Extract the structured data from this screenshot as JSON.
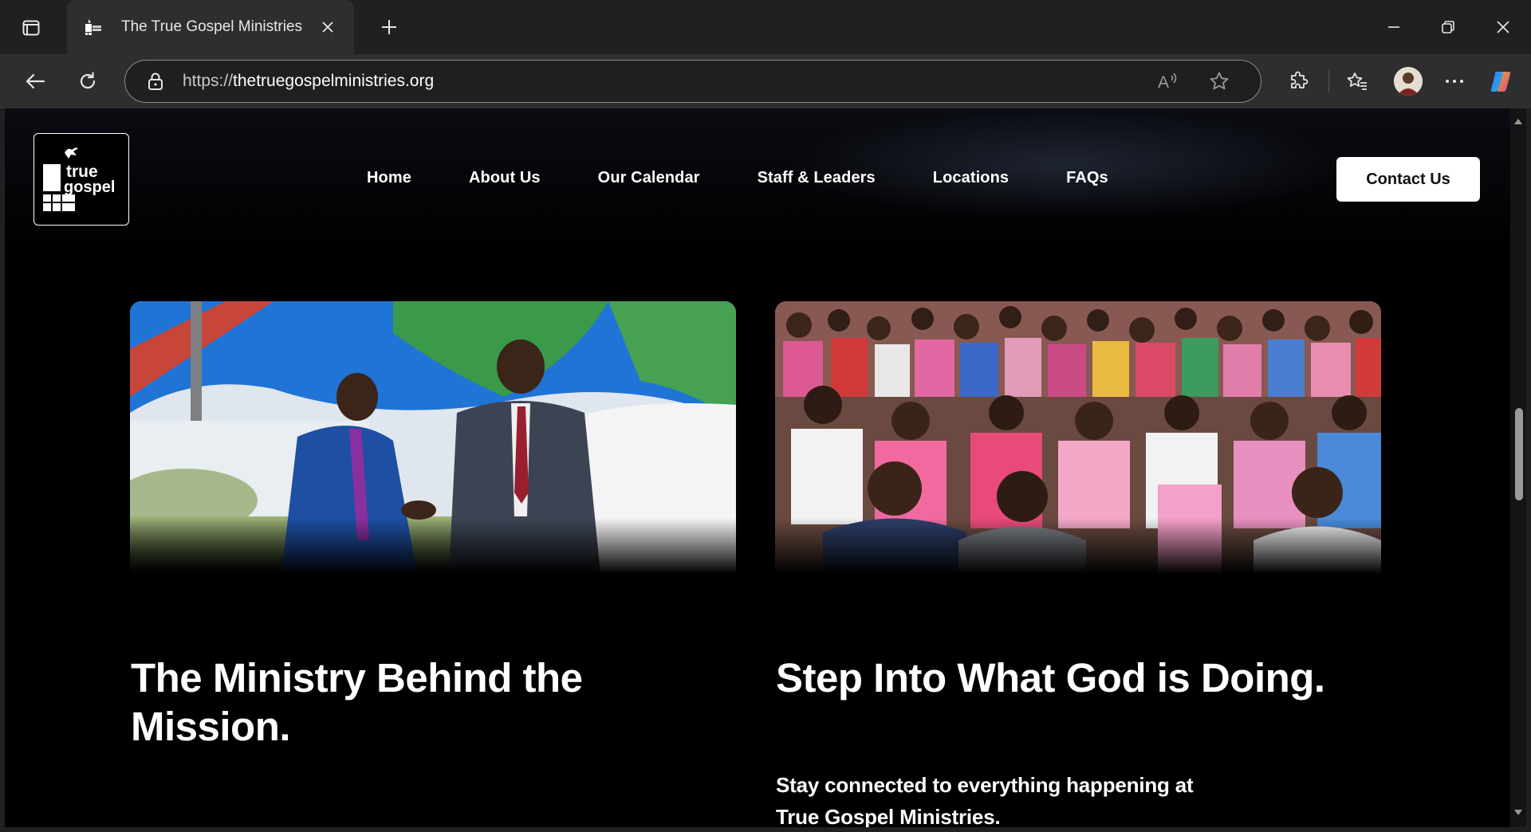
{
  "browser": {
    "tab": {
      "title": "The True Gospel Ministries"
    },
    "address": {
      "scheme": "https://",
      "host": "thetruegospelministries.org"
    },
    "read_aloud_label": "A",
    "colors": {
      "chrome_dark": "#202020",
      "toolbar": "#2e2e2e",
      "page_bg": "#000000"
    }
  },
  "site": {
    "logo": {
      "line1": "true",
      "line2": "gospel"
    },
    "nav": {
      "home": "Home",
      "about": "About Us",
      "calendar": "Our Calendar",
      "staff": "Staff & Leaders",
      "locations": "Locations",
      "faqs": "FAQs"
    },
    "contact_button": "Contact Us"
  },
  "sections": {
    "left": {
      "image": "photo-two-men-shaking-hands-under-tent",
      "heading": "The Ministry Behind the Mission."
    },
    "right": {
      "image": "photo-crowd-praying-outdoors",
      "heading": "Step Into What God is Doing.",
      "paragraph": "Stay connected to everything happening at True Gospel Ministries."
    }
  }
}
